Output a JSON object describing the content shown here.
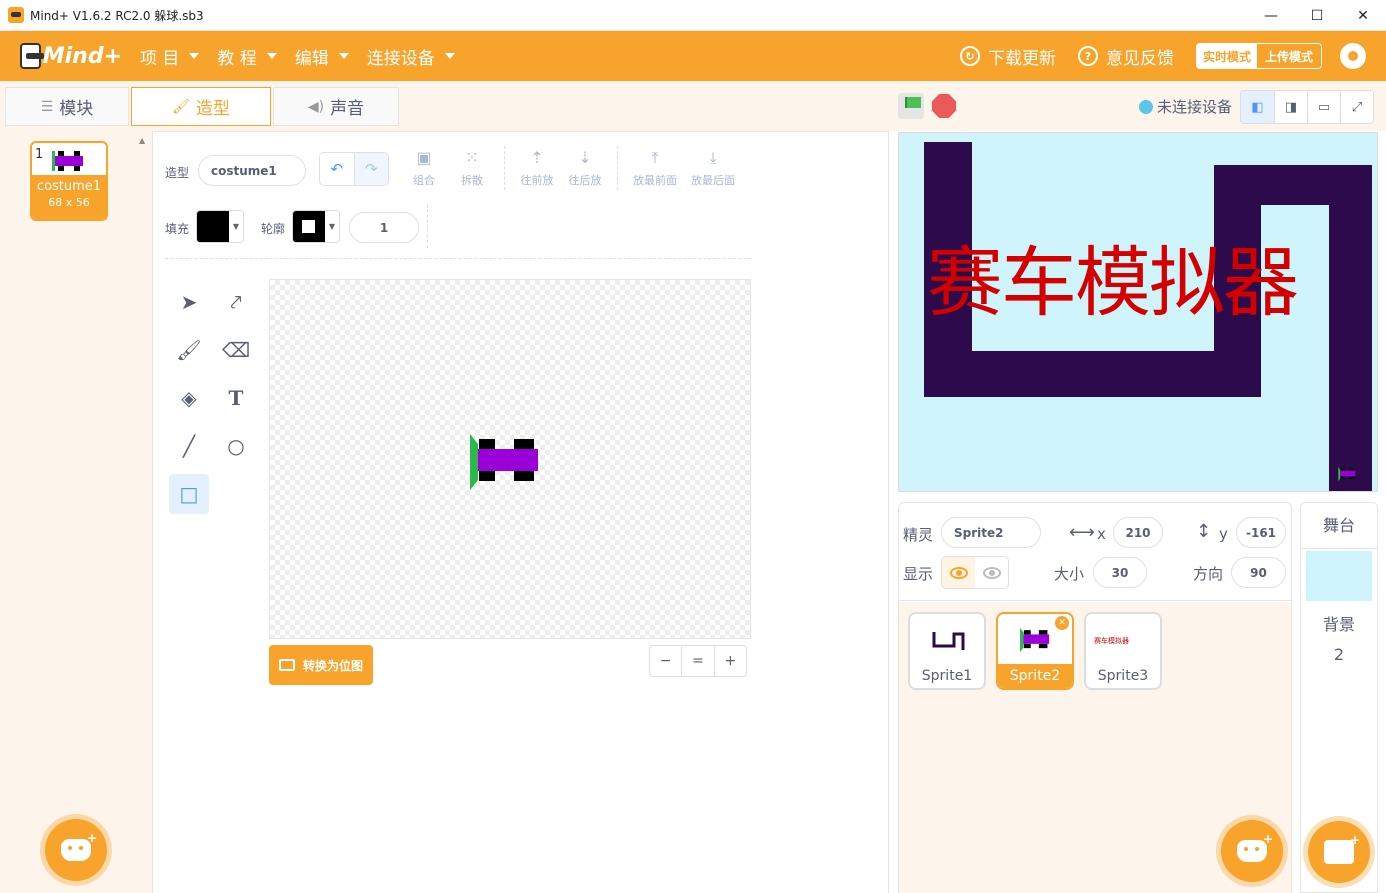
{
  "window": {
    "title": "Mind+ V1.6.2 RC2.0   躲球.sb3",
    "minimize": "—",
    "maximize": "☐",
    "close": "✕"
  },
  "menubar": {
    "logo_text": "Mind+",
    "items": [
      "项 目",
      "教 程",
      "编辑",
      "连接设备"
    ],
    "update": "下载更新",
    "feedback": "意见反馈",
    "mode_realtime": "实时模式",
    "mode_upload": "上传模式"
  },
  "tabs": [
    {
      "label": "模块",
      "icon": "blocks-icon"
    },
    {
      "label": "造型",
      "icon": "brush-icon"
    },
    {
      "label": "声音",
      "icon": "speaker-icon"
    }
  ],
  "costumes": [
    {
      "index": "1",
      "name": "costume1",
      "size": "68 x 56"
    }
  ],
  "editor": {
    "costume_label": "造型",
    "costume_name": "costume1",
    "group": "组合",
    "ungroup": "拆散",
    "forward": "往前放",
    "backward": "往后放",
    "front": "放最前面",
    "back": "放最后面",
    "fill_label": "填充",
    "outline_label": "轮廓",
    "outline_width": "1",
    "convert_bitmap": "转换为位图",
    "zoom_out": "−",
    "zoom_reset": "=",
    "zoom_in": "+"
  },
  "stage_header": {
    "device_status": "未连接设备"
  },
  "stage": {
    "title_text": "赛车模拟器",
    "colors": {
      "bg": "#cff4fb",
      "track": "#2c0a4b",
      "text": "#d40000"
    }
  },
  "sprite_info": {
    "sprite_label": "精灵",
    "sprite_name": "Sprite2",
    "x_label": "x",
    "x": "210",
    "y_label": "y",
    "y": "-161",
    "show_label": "显示",
    "size_label": "大小",
    "size": "30",
    "direction_label": "方向",
    "direction": "90"
  },
  "sprites": [
    {
      "name": "Sprite1"
    },
    {
      "name": "Sprite2"
    },
    {
      "name": "Sprite3",
      "thumb_text": "赛车模拟器"
    }
  ],
  "stage_panel": {
    "header": "舞台",
    "backdrop_label": "背景",
    "backdrop_count": "2"
  },
  "accent_color": "#f8a42c"
}
